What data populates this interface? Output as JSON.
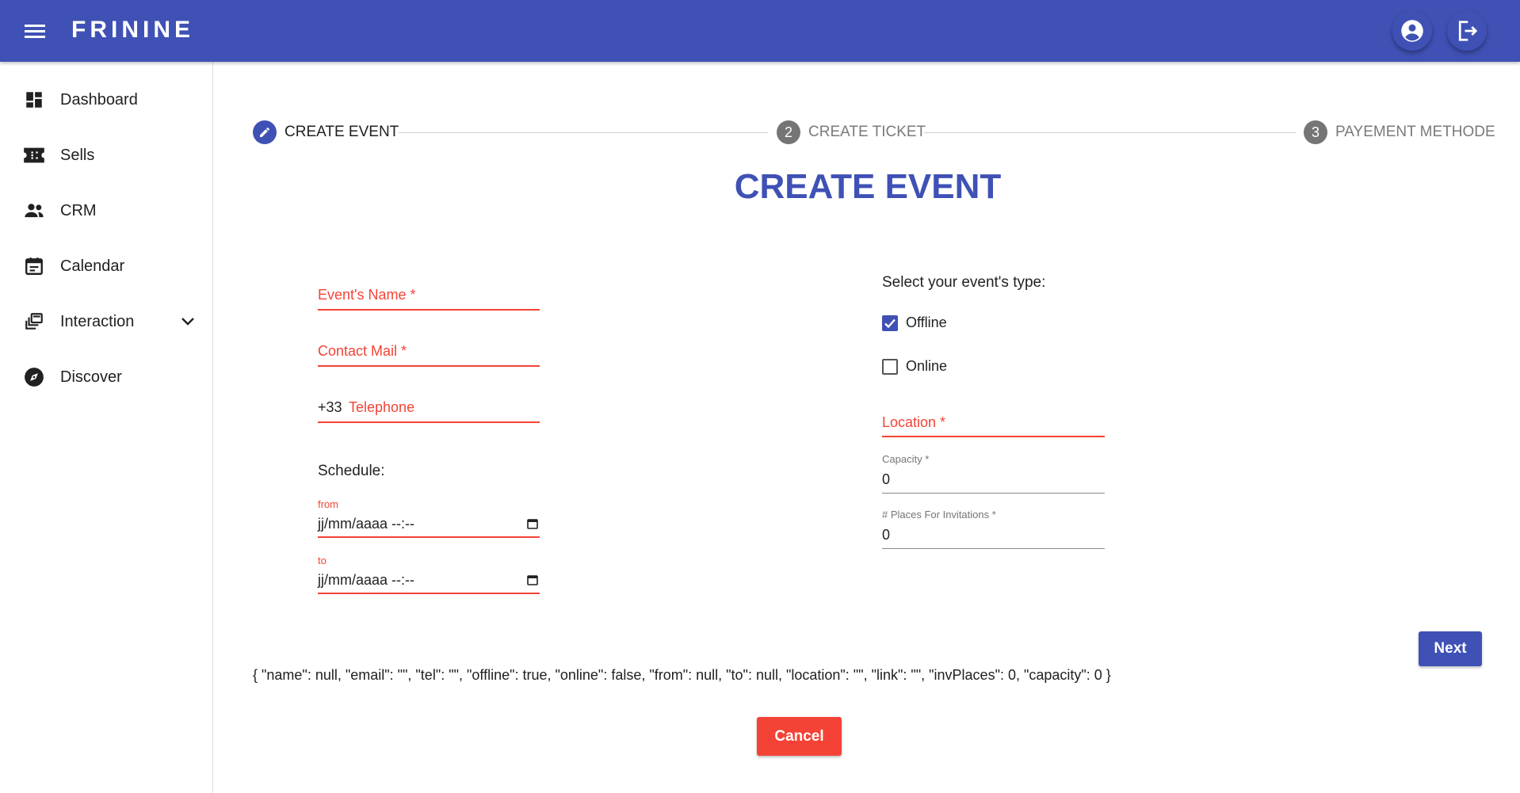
{
  "app": {
    "brand": "FRININE"
  },
  "colors": {
    "primary": "#3f51b5",
    "error": "#f44336"
  },
  "topbar": {
    "menu_icon": "hamburger-menu-icon",
    "account_icon": "account-circle-icon",
    "logout_icon": "logout-icon"
  },
  "sidebar": {
    "items": [
      {
        "label": "Dashboard",
        "icon": "dashboard-icon"
      },
      {
        "label": "Sells",
        "icon": "ticket-icon"
      },
      {
        "label": "CRM",
        "icon": "people-icon"
      },
      {
        "label": "Calendar",
        "icon": "calendar-icon"
      },
      {
        "label": "Interaction",
        "icon": "interaction-icon",
        "expandable": true
      },
      {
        "label": "Discover",
        "icon": "compass-icon"
      }
    ]
  },
  "stepper": {
    "steps": [
      {
        "number": "1",
        "label": "CREATE EVENT",
        "state": "active"
      },
      {
        "number": "2",
        "label": "CREATE TICKET",
        "state": "inactive"
      },
      {
        "number": "3",
        "label": "PAYEMENT METHODE",
        "state": "inactive"
      }
    ]
  },
  "page": {
    "title": "CREATE EVENT"
  },
  "form": {
    "event_name_label": "Event's Name *",
    "contact_mail_label": "Contact Mail *",
    "tel_prefix": "+33",
    "telephone_label": "Telephone",
    "schedule_title": "Schedule:",
    "from_label": "from",
    "from_value": "jj/mm/aaaa --:--",
    "to_label": "to",
    "to_value": "jj/mm/aaaa --:--",
    "type_title": "Select your event's type:",
    "offline_label": "Offline",
    "offline_checked": true,
    "online_label": "Online",
    "online_checked": false,
    "location_label": "Location *",
    "capacity_label": "Capacity *",
    "capacity_value": "0",
    "inv_places_label": "# Places For Invitations *",
    "inv_places_value": "0"
  },
  "debug_text": "{ \"name\": null, \"email\": \"\", \"tel\": \"\", \"offline\": true, \"online\": false, \"from\": null, \"to\": null, \"location\": \"\", \"link\": \"\", \"invPlaces\": 0, \"capacity\": 0 }",
  "buttons": {
    "next": "Next",
    "cancel": "Cancel"
  }
}
